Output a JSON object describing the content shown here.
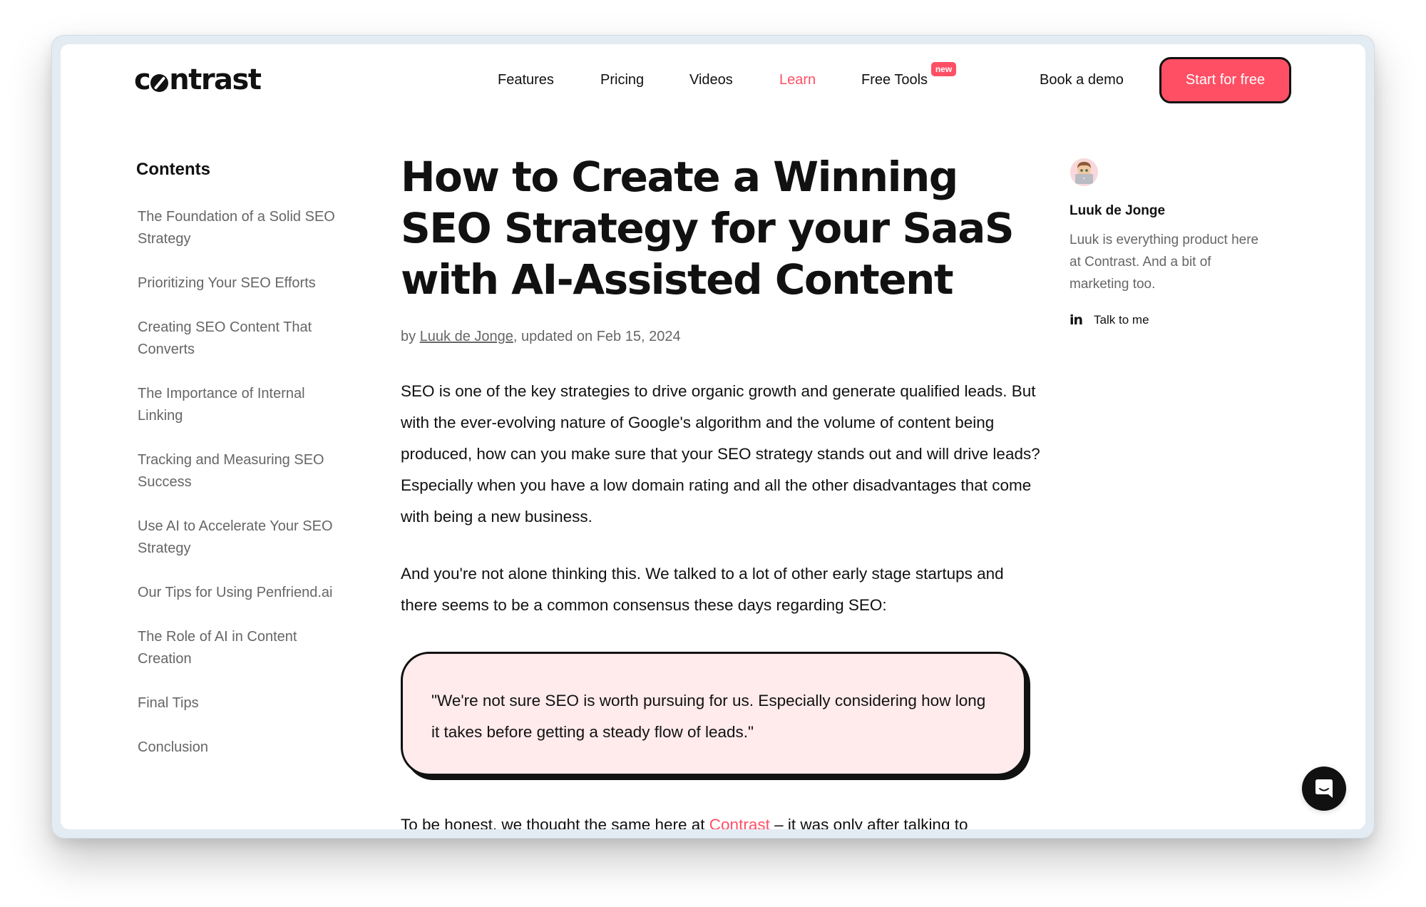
{
  "brand": {
    "logo_prefix": "c",
    "logo_suffix": "ntrast",
    "accent_color": "#ff4f64"
  },
  "nav": {
    "items": [
      {
        "label": "Features",
        "active": false
      },
      {
        "label": "Pricing",
        "active": false
      },
      {
        "label": "Videos",
        "active": false
      },
      {
        "label": "Learn",
        "active": true
      },
      {
        "label": "Free Tools",
        "active": false
      }
    ],
    "badge": "new",
    "book_demo": "Book a demo",
    "cta": "Start for free"
  },
  "toc": {
    "title": "Contents",
    "items": [
      "The Foundation of a Solid SEO Strategy",
      "Prioritizing Your SEO Efforts",
      "Creating SEO Content That Converts",
      "The Importance of Internal Linking",
      "Tracking and Measuring SEO Success",
      "Use AI to Accelerate Your SEO Strategy",
      "Our Tips for Using Penfriend.ai",
      "The Role of AI in Content Creation",
      "Final Tips",
      "Conclusion"
    ]
  },
  "article": {
    "title": "How to Create a Winning SEO Strategy for your SaaS with AI-Assisted Content",
    "byline_prefix": "by ",
    "author_link": "Luuk de Jonge",
    "byline_suffix": ", updated on Feb 15, 2024",
    "paragraph_1": "SEO is one of the key strategies to drive organic growth and generate qualified leads. But with the ever-evolving nature of Google's algorithm and the volume of content being produced, how can you make sure that your SEO strategy stands out and will drive leads? Especially when you have a low domain rating and all the other disadvantages that come with being a new business.",
    "paragraph_2": "And you're not alone thinking this. We talked to a lot of other early stage startups and there seems to be a common consensus these days regarding SEO:",
    "quote": "\"We're not sure SEO is worth pursuing for us. Especially considering how long it takes before getting a steady flow of leads.\"",
    "paragraph_3_prefix": "To be honest, we thought the same here at ",
    "paragraph_3_link": "Contrast",
    "paragraph_3_suffix": " – it was only after talking to"
  },
  "author": {
    "avatar_icon": "memoji-avatar",
    "name": "Luuk de Jonge",
    "bio": "Luuk is everything product here at Contrast. And a bit of marketing too.",
    "social_icon": "linkedin-icon",
    "social_label": "Talk to me"
  },
  "chat": {
    "icon": "chat-bubble-icon"
  }
}
